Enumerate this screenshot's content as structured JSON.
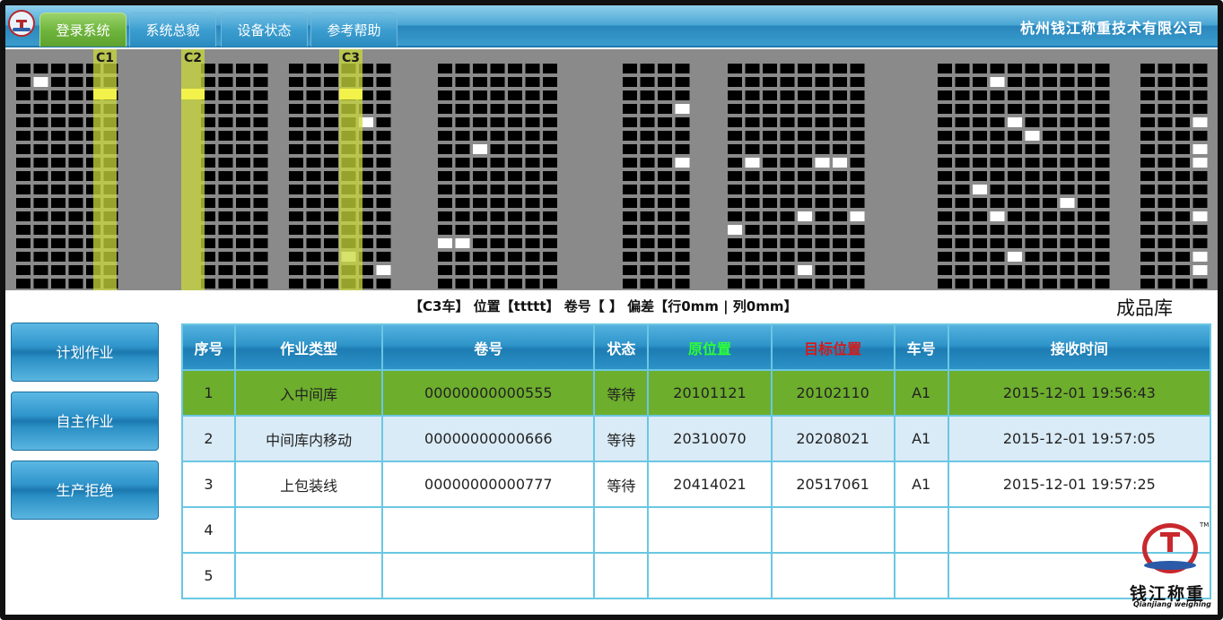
{
  "header": {
    "tabs": [
      {
        "label": "登录系统",
        "active": true
      },
      {
        "label": "系统总貌",
        "active": false
      },
      {
        "label": "设备状态",
        "active": false
      },
      {
        "label": "参考帮助",
        "active": false
      }
    ],
    "company": "杭州钱江称重技术有限公司"
  },
  "map": {
    "cranes": [
      {
        "label": "C1"
      },
      {
        "label": "C2"
      },
      {
        "label": "C3"
      }
    ],
    "colors": {
      "background": "#8a8a8a",
      "slot": "#000000",
      "occupied": "#ffffff",
      "crane": "#c8d83a"
    }
  },
  "status": {
    "text": "【C3车】 位置【ttttt】 卷号【 】 偏差【行0mm | 列0mm】"
  },
  "warehouse_name": "成品库",
  "sidebar": {
    "buttons": [
      {
        "label": "计划作业"
      },
      {
        "label": "自主作业"
      },
      {
        "label": "生产拒绝"
      }
    ]
  },
  "table": {
    "headers": [
      "序号",
      "作业类型",
      "卷号",
      "状态",
      "原位置",
      "目标位置",
      "车号",
      "接收时间"
    ],
    "rows": [
      {
        "seq": "1",
        "type": "入中间库",
        "coil": "00000000000555",
        "status": "等待",
        "from": "20101121",
        "to": "20102110",
        "car": "A1",
        "time": "2015-12-01 19:56:43"
      },
      {
        "seq": "2",
        "type": "中间库内移动",
        "coil": "00000000000666",
        "status": "等待",
        "from": "20310070",
        "to": "20208021",
        "car": "A1",
        "time": "2015-12-01 19:57:05"
      },
      {
        "seq": "3",
        "type": "上包装线",
        "coil": "00000000000777",
        "status": "等待",
        "from": "20414021",
        "to": "20517061",
        "car": "A1",
        "time": "2015-12-01 19:57:25"
      },
      {
        "seq": "4",
        "type": "",
        "coil": "",
        "status": "",
        "from": "",
        "to": "",
        "car": "",
        "time": ""
      },
      {
        "seq": "5",
        "type": "",
        "coil": "",
        "status": "",
        "from": "",
        "to": "",
        "car": "",
        "time": ""
      }
    ]
  },
  "brand": {
    "cn": "钱江称重",
    "en": "Qianjiang weighing",
    "tm": "TM"
  }
}
